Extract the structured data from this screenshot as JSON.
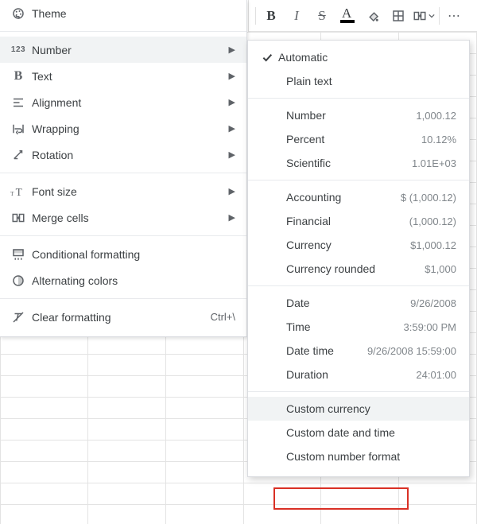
{
  "toolbar": {
    "bold": "B",
    "italic": "I",
    "strike": "S",
    "textcolor_letter": "A",
    "more_dots": "⋯"
  },
  "format_menu": {
    "theme": "Theme",
    "number": "Number",
    "text": "Text",
    "alignment": "Alignment",
    "wrapping": "Wrapping",
    "rotation": "Rotation",
    "font_size": "Font size",
    "merge_cells": "Merge cells",
    "cond_fmt": "Conditional formatting",
    "alt_colors": "Alternating colors",
    "clear_fmt": "Clear formatting",
    "clear_fmt_shortcut": "Ctrl+\\"
  },
  "number_submenu": {
    "automatic": "Automatic",
    "plain_text": "Plain text",
    "items": [
      {
        "label": "Number",
        "sample": "1,000.12"
      },
      {
        "label": "Percent",
        "sample": "10.12%"
      },
      {
        "label": "Scientific",
        "sample": "1.01E+03"
      }
    ],
    "items2": [
      {
        "label": "Accounting",
        "sample": "$ (1,000.12)"
      },
      {
        "label": "Financial",
        "sample": "(1,000.12)"
      },
      {
        "label": "Currency",
        "sample": "$1,000.12"
      },
      {
        "label": "Currency rounded",
        "sample": "$1,000"
      }
    ],
    "items3": [
      {
        "label": "Date",
        "sample": "9/26/2008"
      },
      {
        "label": "Time",
        "sample": "3:59:00 PM"
      },
      {
        "label": "Date time",
        "sample": "9/26/2008 15:59:00"
      },
      {
        "label": "Duration",
        "sample": "24:01:00"
      }
    ],
    "custom_currency": "Custom currency",
    "custom_datetime": "Custom date and time",
    "custom_number": "Custom number format"
  }
}
